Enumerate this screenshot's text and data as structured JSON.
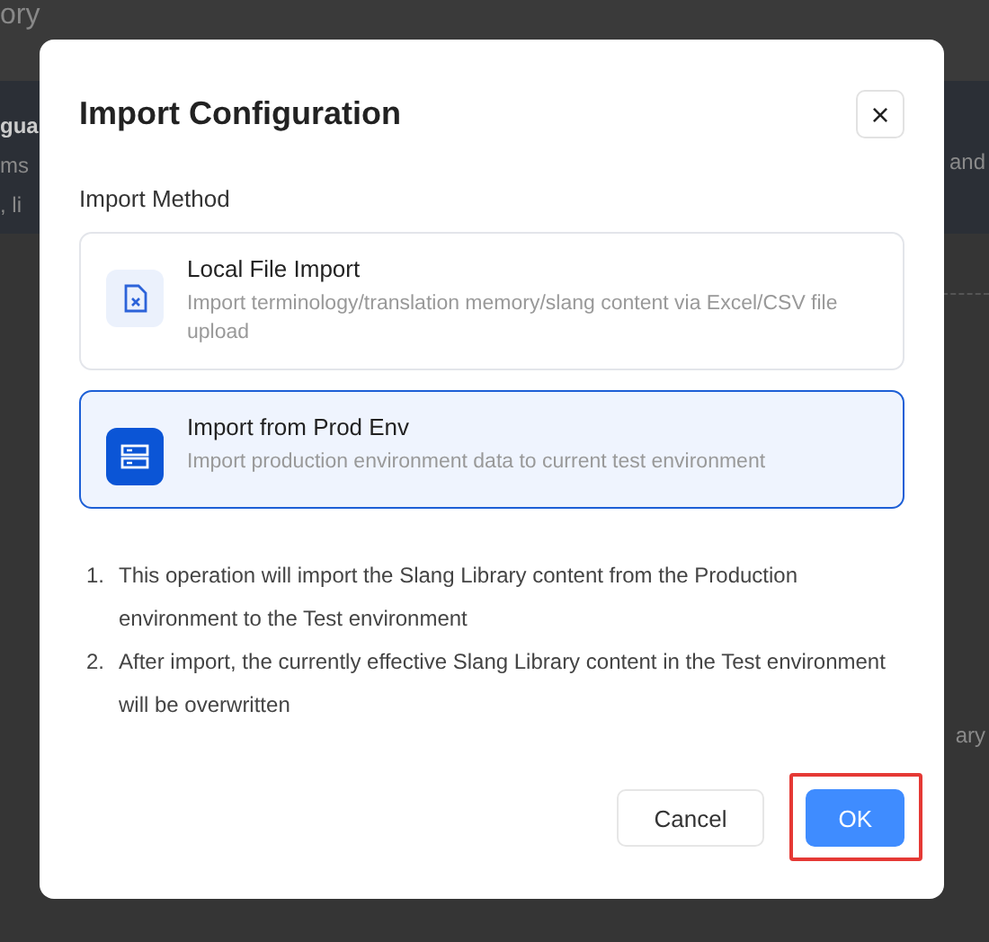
{
  "background": {
    "header_fragment": "ory",
    "left_fragments": [
      {
        "text": "gua",
        "kind": "bold"
      },
      {
        "text": "ms",
        "kind": "plain"
      },
      {
        "text": ", li",
        "kind": "plain"
      }
    ],
    "right_fragments": [
      "and",
      "ary"
    ]
  },
  "dialog": {
    "title": "Import Configuration",
    "close": "×",
    "section_label": "Import Method",
    "methods": [
      {
        "title": "Local File Import",
        "description": "Import terminology/translation memory/slang content via Excel/CSV file upload",
        "kind": "file",
        "selected": false
      },
      {
        "title": "Import from Prod Env",
        "description": "Import production environment data to current test environment",
        "kind": "server",
        "selected": true
      }
    ],
    "notes": [
      {
        "number": "1.",
        "text": "This operation will import the Slang Library content from the Production environment to the Test environment"
      },
      {
        "number": "2.",
        "text": "After import, the currently effective Slang Library content in the Test environment will be overwritten"
      }
    ],
    "buttons": [
      {
        "label": "Cancel",
        "kind": "default",
        "highlighted": false
      },
      {
        "label": "OK",
        "kind": "primary",
        "highlighted": true
      }
    ]
  }
}
